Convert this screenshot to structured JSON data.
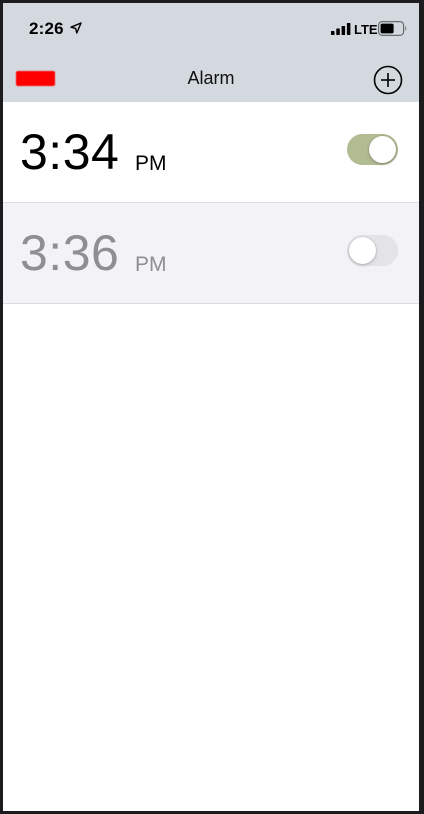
{
  "status_bar": {
    "time": "2:26",
    "network": "LTE",
    "icons": [
      "location-arrow-icon",
      "signal-bars-icon",
      "battery-icon"
    ]
  },
  "nav": {
    "title": "Alarm",
    "back_label_redacted": true,
    "add_icon": "plus-circle-icon"
  },
  "alarms": [
    {
      "time": "3:34",
      "period": "PM",
      "enabled": true
    },
    {
      "time": "3:36",
      "period": "PM",
      "enabled": false
    }
  ],
  "colors": {
    "bar_background": "#d3d9df",
    "toggle_on": "#b2bc93",
    "toggle_off": "#e4e4e8",
    "inactive_text": "#8e8e93",
    "redaction": "#ff0000"
  }
}
